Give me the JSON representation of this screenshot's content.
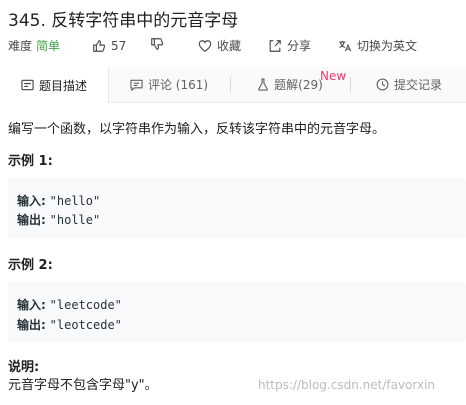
{
  "problem": {
    "title": "345. 反转字符串中的元音字母",
    "difficulty_label": "难度",
    "difficulty_value": "简单",
    "likes": "57",
    "favorite_label": "收藏",
    "share_label": "分享",
    "translate_label": "切换为英文"
  },
  "tabs": [
    {
      "label": "题目描述",
      "icon": "description-icon",
      "active": true
    },
    {
      "label": "评论 (161)",
      "icon": "comment-icon",
      "active": false
    },
    {
      "label": "题解(29)",
      "icon": "flask-icon",
      "active": false,
      "badge": "New"
    },
    {
      "label": "提交记录",
      "icon": "history-icon",
      "active": false
    }
  ],
  "description": "编写一个函数，以字符串作为输入，反转该字符串中的元音字母。",
  "examples": [
    {
      "title": "示例 1:",
      "input_label": "输入:",
      "input": "\"hello\"",
      "output_label": "输出:",
      "output": "\"holle\""
    },
    {
      "title": "示例 2:",
      "input_label": "输入:",
      "input": "\"leetcode\"",
      "output_label": "输出:",
      "output": "\"leotcede\""
    }
  ],
  "note": {
    "title": "说明:",
    "text": "元音字母不包含字母\"y\"。"
  },
  "watermark": "https://blog.csdn.net/favorxin",
  "colors": {
    "easy": "#43a047",
    "new_badge": "#f5386b",
    "example_bg": "#f7f9fa",
    "tab_bar_bg": "#fafafa"
  }
}
